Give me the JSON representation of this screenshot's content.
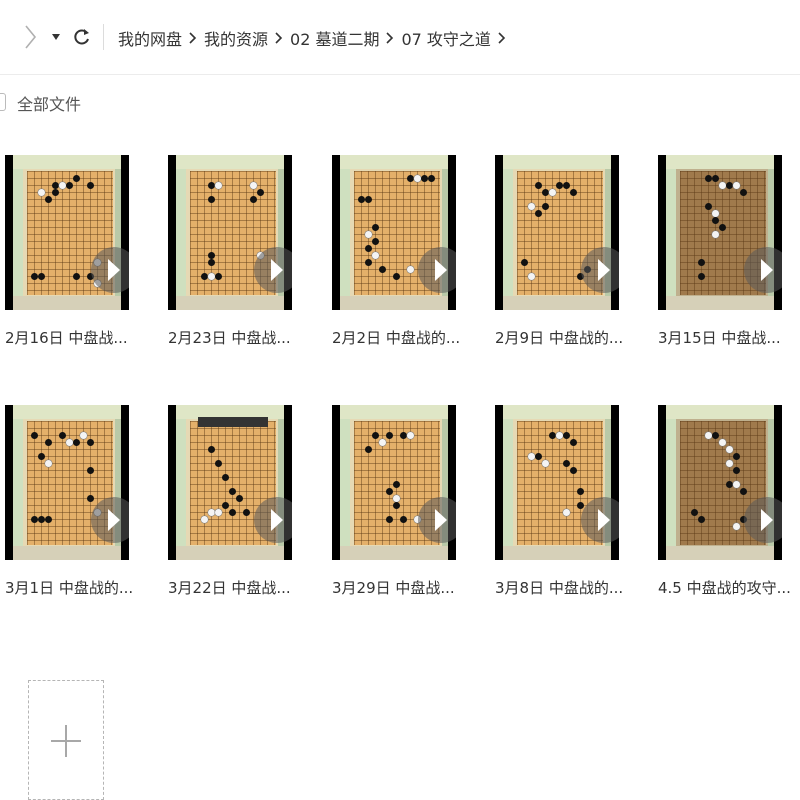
{
  "nav": {
    "forward_icon": "chevron-right-icon",
    "dropdown_icon": "caret-down-icon",
    "refresh_icon": "refresh-icon",
    "breadcrumbs": [
      "我的网盘",
      "我的资源",
      "02 墓道二期",
      "07 攻守之道"
    ]
  },
  "filter": {
    "label": "全部文件"
  },
  "files": [
    {
      "name": "2月16日 中盘战..."
    },
    {
      "name": "2月23日 中盘战..."
    },
    {
      "name": "2月2日 中盘战的..."
    },
    {
      "name": "2月9日 中盘战的..."
    },
    {
      "name": "3月15日 中盘战..."
    },
    {
      "name": "3月1日 中盘战的..."
    },
    {
      "name": "3月22日 中盘战..."
    },
    {
      "name": "3月29日 中盘战..."
    },
    {
      "name": "3月8日 中盘战的..."
    },
    {
      "name": "4.5 中盘战的攻守..."
    }
  ],
  "add_button": {
    "icon": "plus-icon"
  },
  "colors": {
    "board": "#e4b06a",
    "video_frame": "#000000",
    "text": "#333333"
  }
}
